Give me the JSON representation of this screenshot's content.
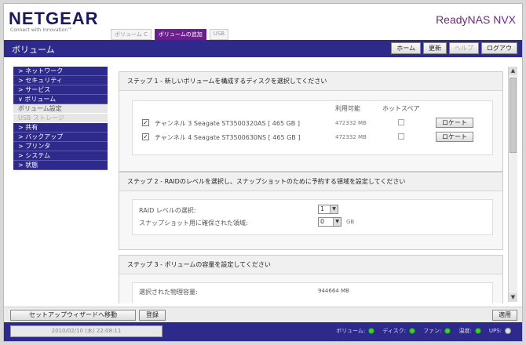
{
  "header": {
    "logo": "NETGEAR",
    "logo_sub": "Connect with Innovation™",
    "product": "ReadyNAS NVX",
    "tabs": [
      {
        "label": "ボリューム C"
      },
      {
        "label": "ボリュームの追加"
      },
      {
        "label": "USB"
      }
    ]
  },
  "titlebar": {
    "title": "ボリューム",
    "buttons": {
      "home": "ホーム",
      "refresh": "更新",
      "help": "ヘルプ",
      "logout": "ログアウ"
    }
  },
  "sidebar": {
    "items": [
      {
        "label": "> ネットワーク"
      },
      {
        "label": "> セキュリティ"
      },
      {
        "label": "> サービス"
      },
      {
        "label": "∨ ボリューム"
      },
      {
        "label": "ボリューム設定"
      },
      {
        "label": "USB ストレージ"
      },
      {
        "label": "> 共有"
      },
      {
        "label": "> バックアップ"
      },
      {
        "label": "> プリンタ"
      },
      {
        "label": "> システム"
      },
      {
        "label": "> 状態"
      }
    ]
  },
  "step1": {
    "title": "ステップ 1 - 新しいボリュームを構成するディスクを選択してください",
    "col_available": "利用可能",
    "col_hotspare": "ホットスペア",
    "disks": [
      {
        "name": "チャンネル 3 Seagate ST3500320AS [ 465 GB ]",
        "available": "472332 MB",
        "locate": "ロケート"
      },
      {
        "name": "チャンネル 4 Seagate ST3500630NS [ 465 GB ]",
        "available": "472332 MB",
        "locate": "ロケート"
      }
    ]
  },
  "step2": {
    "title": "ステップ 2 - RAIDのレベルを選択し、スナップショットのために予約する領域を設定してください",
    "raid_label": "RAID レベルの選択:",
    "raid_value": "1",
    "snapshot_label": "スナップショット用に確保された領域:",
    "snapshot_value": "0",
    "snapshot_unit": "GB"
  },
  "step3": {
    "title": "ステップ 3 - ボリュームの容量を設定してください",
    "selected_label": "選択された物理容量:",
    "selected_value": "944664 MB"
  },
  "bottom": {
    "wizard": "セットアップウィザードへ移動",
    "apply": "登録",
    "save": "適用"
  },
  "status": {
    "time": "2010/02/10 (水) 22:08:11",
    "leds": [
      {
        "label": "ボリューム:",
        "on": true
      },
      {
        "label": "ディスク:",
        "on": true
      },
      {
        "label": "ファン:",
        "on": true
      },
      {
        "label": "温度:",
        "on": true
      },
      {
        "label": "UPS:",
        "on": false
      }
    ]
  }
}
